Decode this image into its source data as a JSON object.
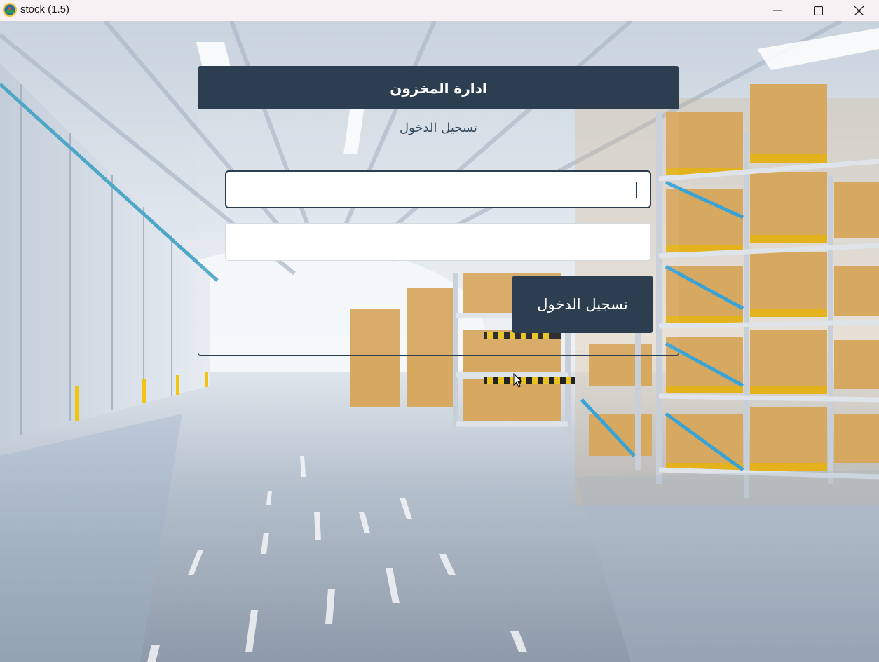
{
  "window": {
    "title": "stock (1.5)",
    "controls": [
      "minimize-icon",
      "maximize-icon",
      "close-icon"
    ]
  },
  "login": {
    "header_title": "ادارة المخزون",
    "subtitle": "تسجيل الدخول",
    "username": {
      "value": "",
      "placeholder": ""
    },
    "password": {
      "value": "",
      "placeholder": ""
    },
    "submit_label": "تسجيل الدخول"
  },
  "colors": {
    "primary": "#2c3e50",
    "text_on_primary": "#ffffff",
    "subtitle": "#34495e",
    "titlebar_bg": "#f7f1f3"
  }
}
